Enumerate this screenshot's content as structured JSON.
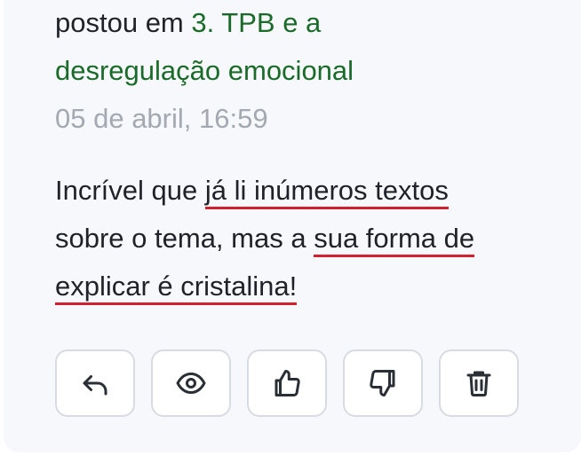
{
  "post": {
    "action_text": "postou em",
    "topic_link_part1": "3. TPB e a",
    "topic_link_part2": "desregulação emocional",
    "timestamp": "05 de abril, 16:59"
  },
  "comment": {
    "line1_plain": "Incrível que",
    "line1_highlight": "já li inúmeros textos",
    "line2_plain": "sobre o tema, mas a",
    "line2_highlight": "sua forma de",
    "line3_highlight": "explicar é cristalina!"
  },
  "colors": {
    "link": "#1a6b2a",
    "timestamp": "#a4a9b1",
    "underline": "#d4202c"
  },
  "actions": [
    {
      "name": "reply",
      "icon": "reply-icon"
    },
    {
      "name": "view",
      "icon": "eye-icon"
    },
    {
      "name": "like",
      "icon": "thumbs-up-icon"
    },
    {
      "name": "dislike",
      "icon": "thumbs-down-icon"
    },
    {
      "name": "delete",
      "icon": "trash-icon"
    }
  ]
}
